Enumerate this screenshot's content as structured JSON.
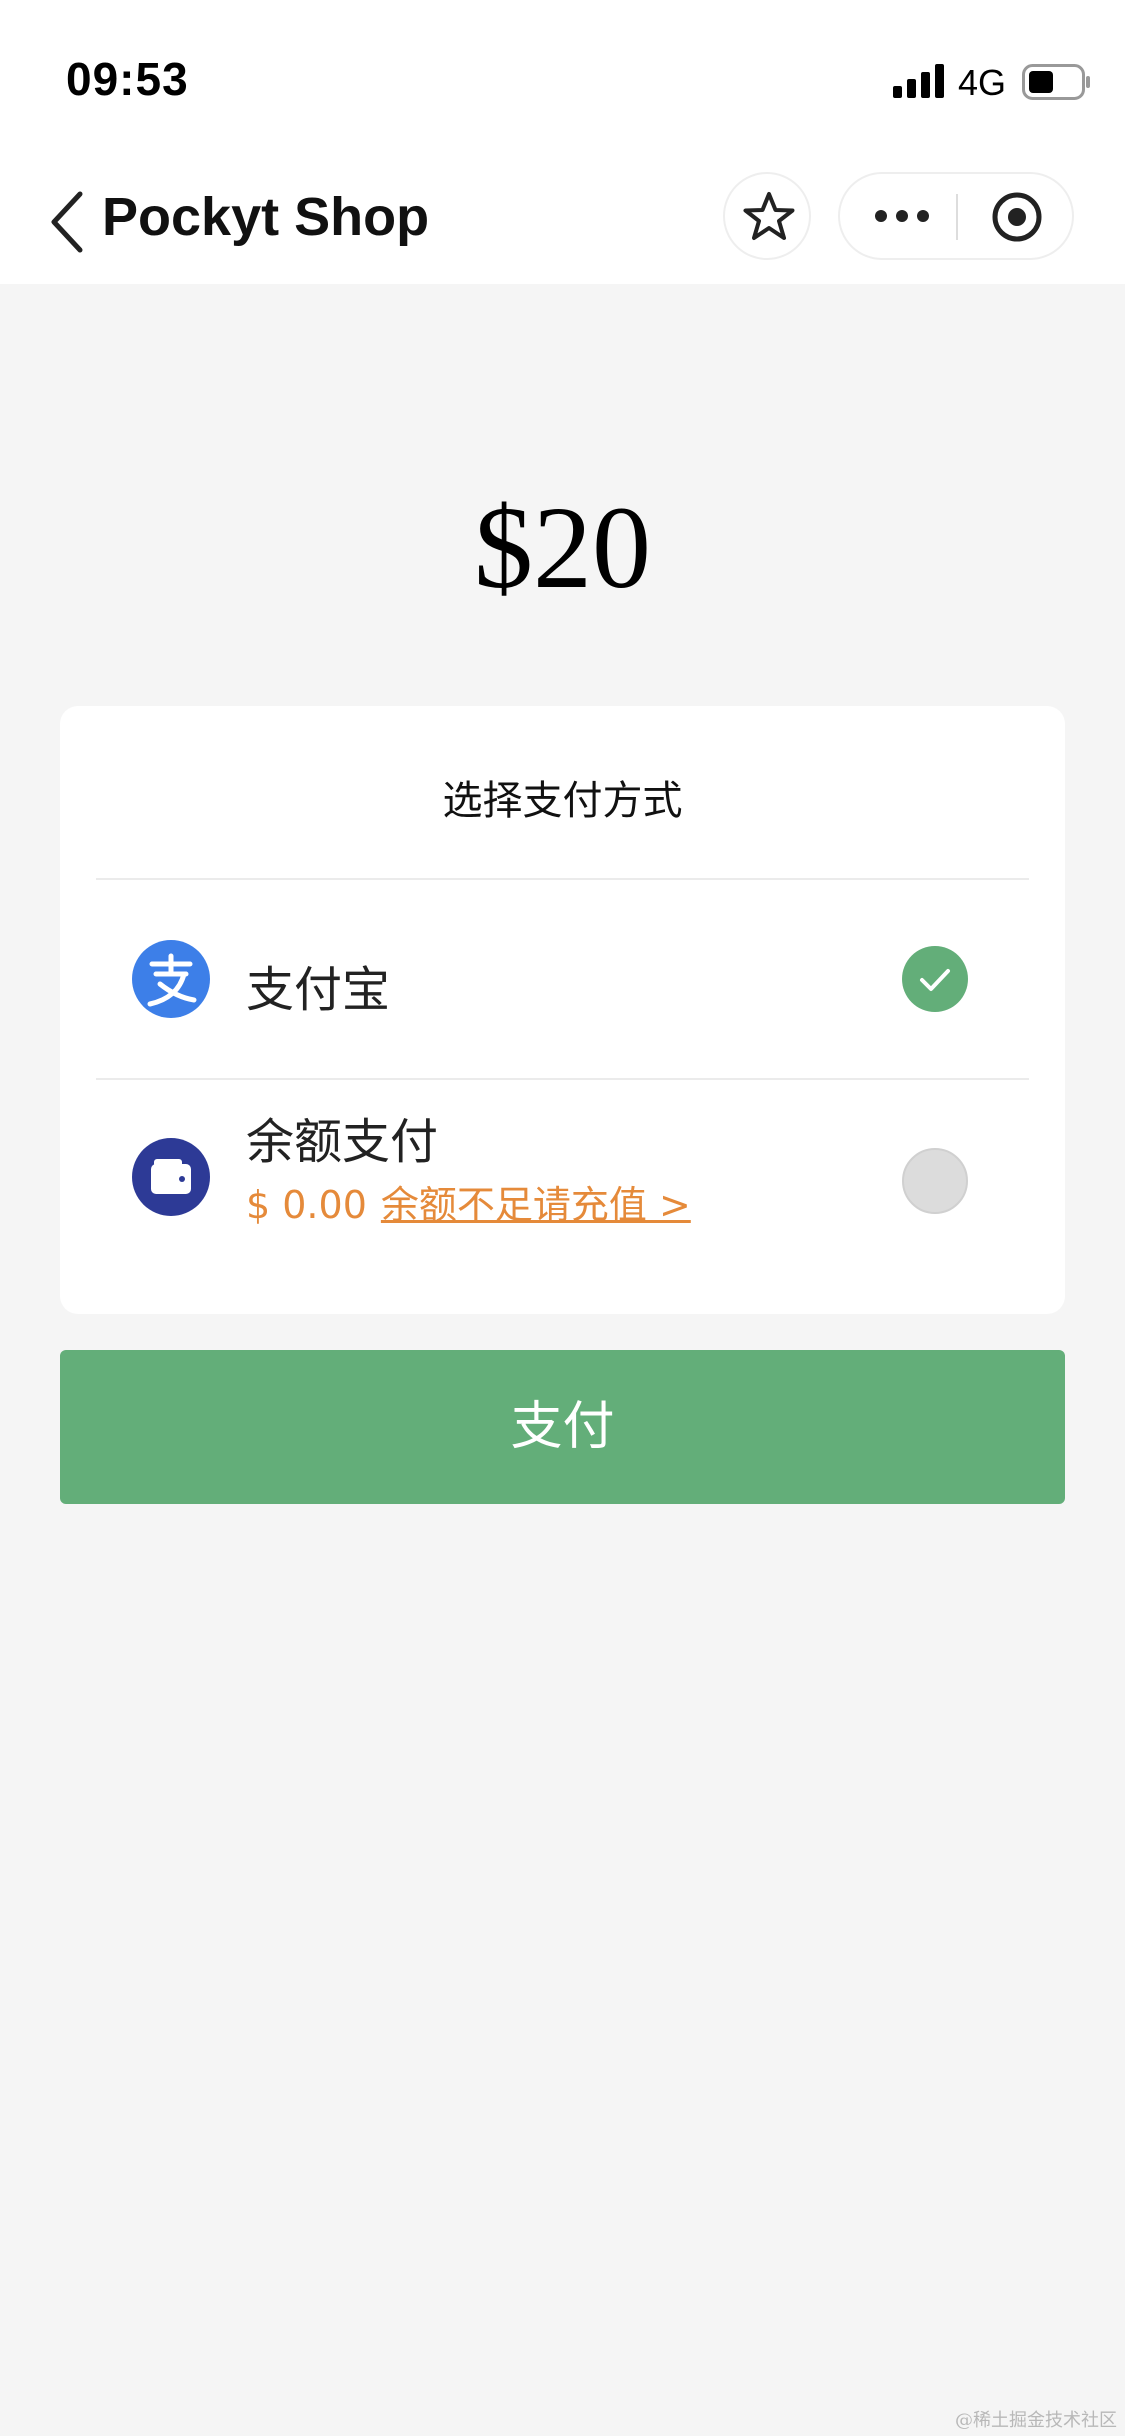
{
  "status_bar": {
    "time": "09:53",
    "network": "4G"
  },
  "nav": {
    "title": "Pockyt Shop",
    "icons": [
      "back-icon",
      "star-icon",
      "more-icon",
      "close-circle-icon"
    ]
  },
  "amount": "$20",
  "payment_card": {
    "title": "选择支付方式",
    "options": [
      {
        "label": "支付宝",
        "icon": "alipay-icon",
        "selected": true
      },
      {
        "label": "余额支付",
        "icon": "wallet-icon",
        "balance": "$ 0.00",
        "recharge_link": "余额不足请充值 >",
        "selected": false
      }
    ]
  },
  "pay_button": {
    "label": "支付"
  },
  "watermark": "@稀土掘金技术社区",
  "colors": {
    "accent_green": "#63ae79",
    "alipay_blue": "#3d7fe8",
    "wallet_indigo": "#2d3a96",
    "warning_orange": "#e58a3a",
    "background": "#f5f5f5"
  }
}
